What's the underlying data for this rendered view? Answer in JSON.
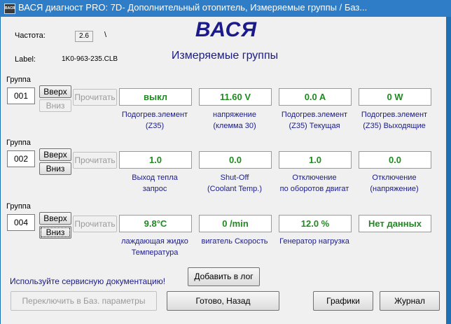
{
  "window": {
    "icon_text": "BACR",
    "title": "ВАСЯ диагност PRO: 7D- Дополнительный отопитель,  Измеряемые группы / Баз..."
  },
  "header": {
    "freq_label": "Частота:",
    "freq_value": "2.6",
    "freq_marker": "\\",
    "label_label": "Label:",
    "label_value": "1K0-963-235.CLB",
    "brand": "ВАСЯ",
    "subtitle": "Измеряемые группы"
  },
  "groups": [
    {
      "title": "Группа",
      "number": "001",
      "up": "Вверх",
      "down": "Вниз",
      "read": "Прочитать",
      "values": [
        "выкл",
        "11.60 V",
        "0.0 A",
        "0 W"
      ],
      "captions": [
        [
          "Подогрев.элемент",
          "(Z35)"
        ],
        [
          "напряжение",
          "(клемма 30)"
        ],
        [
          "Подогрев.элемент",
          "(Z35) Текущая"
        ],
        [
          "Подогрев.элемент",
          "(Z35) Выходящие"
        ]
      ]
    },
    {
      "title": "Группа",
      "number": "002",
      "up": "Вверх",
      "down": "Вниз",
      "read": "Прочитать",
      "values": [
        "1.0",
        "0.0",
        "1.0",
        "0.0"
      ],
      "captions": [
        [
          "Выход тепла",
          "запрос"
        ],
        [
          "Shut-Off",
          "(Coolant Temp.)"
        ],
        [
          "Отключение",
          "по оборотов двигат"
        ],
        [
          "Отключение",
          "(напряжение)"
        ]
      ]
    },
    {
      "title": "Группа",
      "number": "004",
      "up": "Вверх",
      "down": "Вниз",
      "read": "Прочитать",
      "values": [
        "9.8°C",
        "0 /min",
        "12.0 %",
        "Нет данных"
      ],
      "captions": [
        [
          "лаждающая жидко",
          "Температура"
        ],
        [
          "вигатель Скорость",
          ""
        ],
        [
          "Генератор нагрузка",
          ""
        ],
        [
          "",
          ""
        ]
      ]
    }
  ],
  "footer": {
    "hint": "Используйте сервисную документацию!",
    "add_log": "Добавить в лог",
    "switch_base": "Переключить в Баз. параметры",
    "done_back": "Готово, Назад",
    "graphs": "Графики",
    "journal": "Журнал"
  },
  "colors": {
    "value_text": "#1f8a1f",
    "caption_text": "#1a1a8a",
    "titlebar": "#2e7dc6"
  }
}
